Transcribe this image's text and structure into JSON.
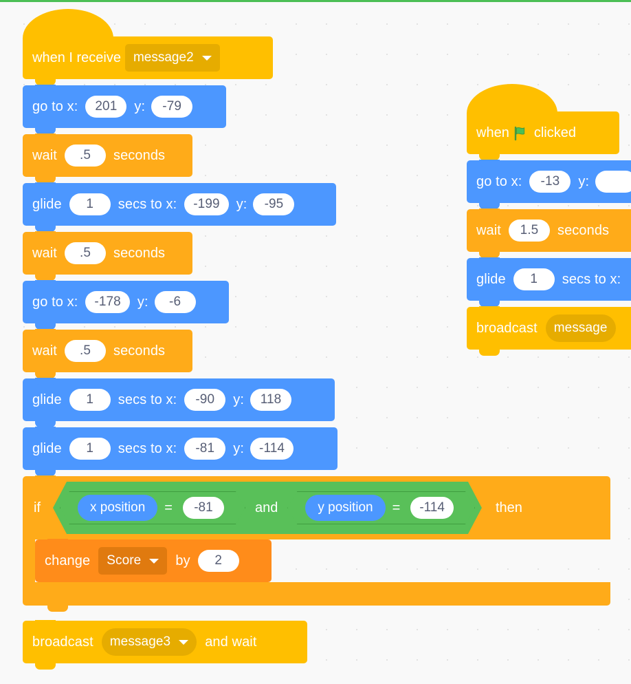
{
  "app": {
    "name": "Scratch",
    "view": "block-editor-workspace"
  },
  "colors": {
    "events": "#ffbf00",
    "motion": "#4c97ff",
    "control": "#ffab19",
    "variables": "#ff8c1a",
    "operators": "#59c059",
    "workspace_background": "#f9f9f9",
    "top_rule": "#4cbf56",
    "input_text": "#575e75"
  },
  "scripts": [
    {
      "id": "script-receive-message2",
      "hat": {
        "type": "when-i-receive",
        "label": "when I receive",
        "dropdown_value": "message2"
      },
      "blocks": [
        {
          "type": "go-to-xy",
          "label": "go to x:",
          "x_value": "201",
          "label_y": "y:",
          "y_value": "-79"
        },
        {
          "type": "wait-seconds",
          "label": "wait",
          "value": ".5",
          "label_after": "seconds"
        },
        {
          "type": "glide-secs-to-xy",
          "label": "glide",
          "secs_value": "1",
          "label_mid": "secs to x:",
          "x_value": "-199",
          "label_y": "y:",
          "y_value": "-95"
        },
        {
          "type": "wait-seconds",
          "label": "wait",
          "value": ".5",
          "label_after": "seconds"
        },
        {
          "type": "go-to-xy",
          "label": "go to x:",
          "x_value": "-178",
          "label_y": "y:",
          "y_value": "-6"
        },
        {
          "type": "wait-seconds",
          "label": "wait",
          "value": ".5",
          "label_after": "seconds"
        },
        {
          "type": "glide-secs-to-xy",
          "label": "glide",
          "secs_value": "1",
          "label_mid": "secs to x:",
          "x_value": "-90",
          "label_y": "y:",
          "y_value": "118"
        },
        {
          "type": "glide-secs-to-xy",
          "label": "glide",
          "secs_value": "1",
          "label_mid": "secs to x:",
          "x_value": "-81",
          "label_y": "y:",
          "y_value": "-114"
        }
      ],
      "if_block": {
        "type": "if-then",
        "label_if": "if",
        "label_then": "then",
        "condition": {
          "type": "and",
          "label": "and",
          "left": {
            "type": "equals",
            "operand_reporter": "x position",
            "operator": "=",
            "operand_value": "-81"
          },
          "right": {
            "type": "equals",
            "operand_reporter": "y position",
            "operator": "=",
            "operand_value": "-114"
          }
        },
        "body": [
          {
            "type": "change-variable-by",
            "label": "change",
            "variable": "Score",
            "label_by": "by",
            "value": "2"
          }
        ]
      },
      "trailing_blocks": [
        {
          "type": "broadcast-and-wait",
          "label": "broadcast",
          "dropdown_value": "message3",
          "label_after": "and wait"
        }
      ]
    },
    {
      "id": "script-green-flag",
      "hat": {
        "type": "when-flag-clicked",
        "label_before": "when",
        "icon": "green-flag-icon",
        "label_after": "clicked"
      },
      "blocks": [
        {
          "type": "go-to-xy",
          "label": "go to x:",
          "x_value": "-13",
          "label_y": "y:",
          "y_value": ""
        },
        {
          "type": "wait-seconds",
          "label": "wait",
          "value": "1.5",
          "label_after": "seconds"
        },
        {
          "type": "glide-secs-to-xy",
          "label": "glide",
          "secs_value": "1",
          "label_mid": "secs to x:",
          "x_value": "",
          "label_y": "",
          "y_value": ""
        },
        {
          "type": "broadcast",
          "label": "broadcast",
          "dropdown_value": "message"
        }
      ]
    }
  ]
}
